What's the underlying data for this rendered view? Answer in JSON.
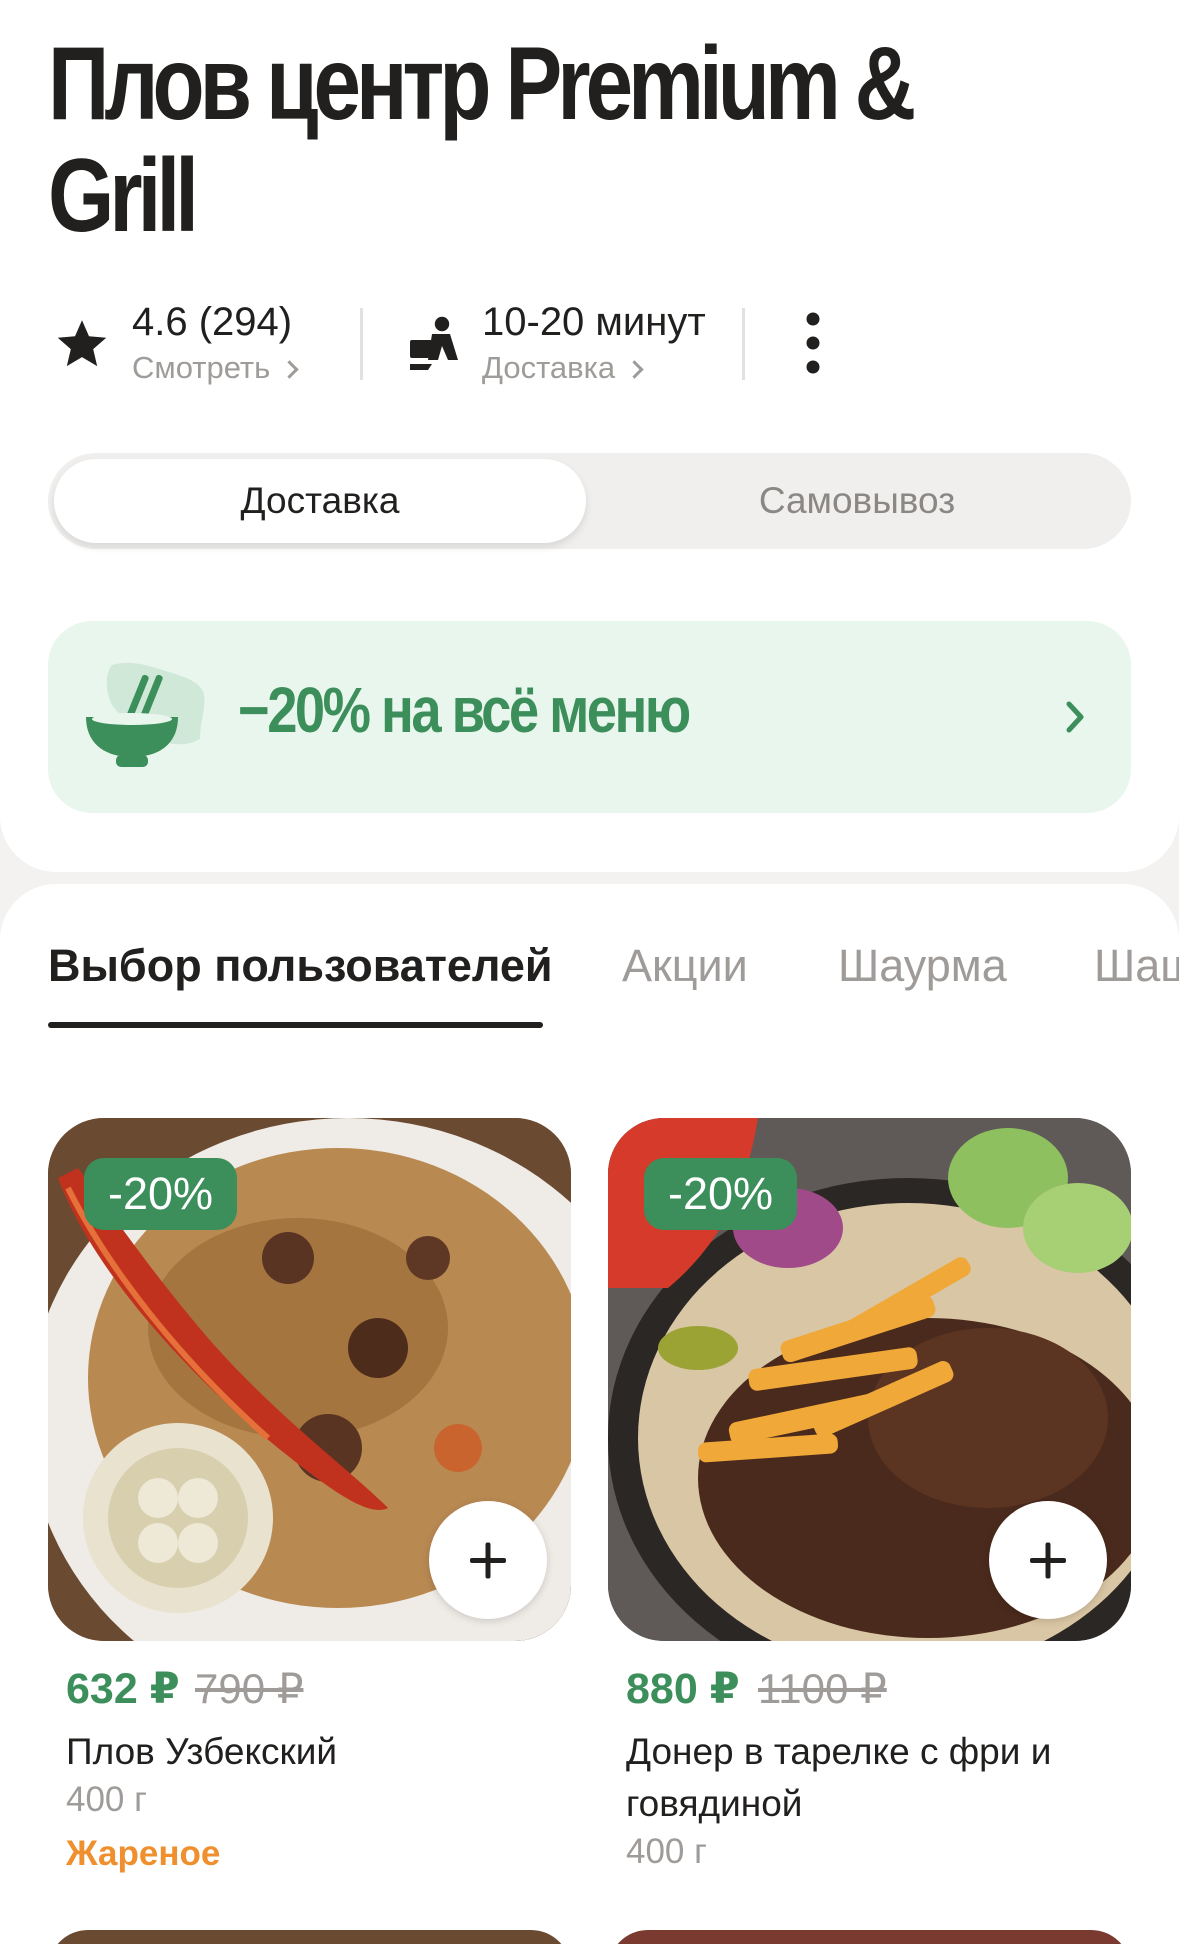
{
  "restaurant": {
    "title_line1": "Плов центр Premium &",
    "title_line2": "Grill"
  },
  "meta": {
    "rating": "4.6 (294)",
    "rating_link": "Смотреть",
    "delivery_time": "10-20 минут",
    "delivery_link": "Доставка",
    "more_icon": "more-vertical-icon"
  },
  "mode_switch": {
    "options": [
      "Доставка",
      "Самовывоз"
    ],
    "selected": "Доставка"
  },
  "promo": {
    "text": "−20% на всё меню",
    "icon": "bowl-chopsticks-icon"
  },
  "category_tabs": {
    "items": [
      "Выбор пользователей",
      "Акции",
      "Шаурма",
      "Шаш"
    ],
    "selected": "Выбор пользователей"
  },
  "products": [
    {
      "badge": "-20%",
      "price_new": "632 ₽",
      "price_old": "790 ₽",
      "name": "Плов Узбекский",
      "weight": "400 г",
      "tag": "Жареное"
    },
    {
      "badge": "-20%",
      "price_new": "880 ₽",
      "price_old": "1100 ₽",
      "name": "Донер в тарелке с фри и говядиной",
      "weight": "400 г",
      "tag": ""
    }
  ],
  "colors": {
    "accent_green": "#3c8f5b",
    "promo_bg": "#e9f6ed",
    "tag_orange": "#ef8f2e",
    "muted": "#9e9b98"
  }
}
